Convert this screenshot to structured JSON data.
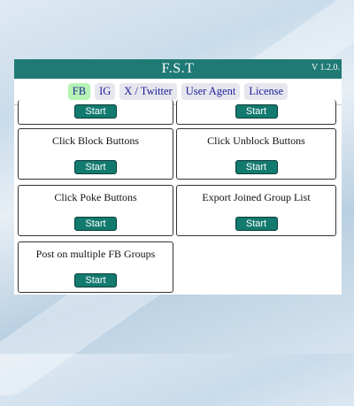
{
  "header": {
    "title": "F.S.T",
    "version": "V 1.2.0."
  },
  "tabs": [
    {
      "label": "FB",
      "active": true
    },
    {
      "label": "IG",
      "active": false
    },
    {
      "label": "X / Twitter",
      "active": false
    },
    {
      "label": "User Agent",
      "active": false
    },
    {
      "label": "License",
      "active": false
    }
  ],
  "cards": [
    {
      "label": "",
      "button": "Start"
    },
    {
      "label": "",
      "button": "Start"
    },
    {
      "label": "Click Block Buttons",
      "button": "Start"
    },
    {
      "label": "Click Unblock Buttons",
      "button": "Start"
    },
    {
      "label": "Click Poke Buttons",
      "button": "Start"
    },
    {
      "label": "Export Joined Group List",
      "button": "Start"
    },
    {
      "label": "Post on multiple FB Groups",
      "button": "Start"
    }
  ],
  "colors": {
    "header_bg": "#1f7a76",
    "button_bg": "#137a6f",
    "active_tab": "#b6f3b4"
  }
}
